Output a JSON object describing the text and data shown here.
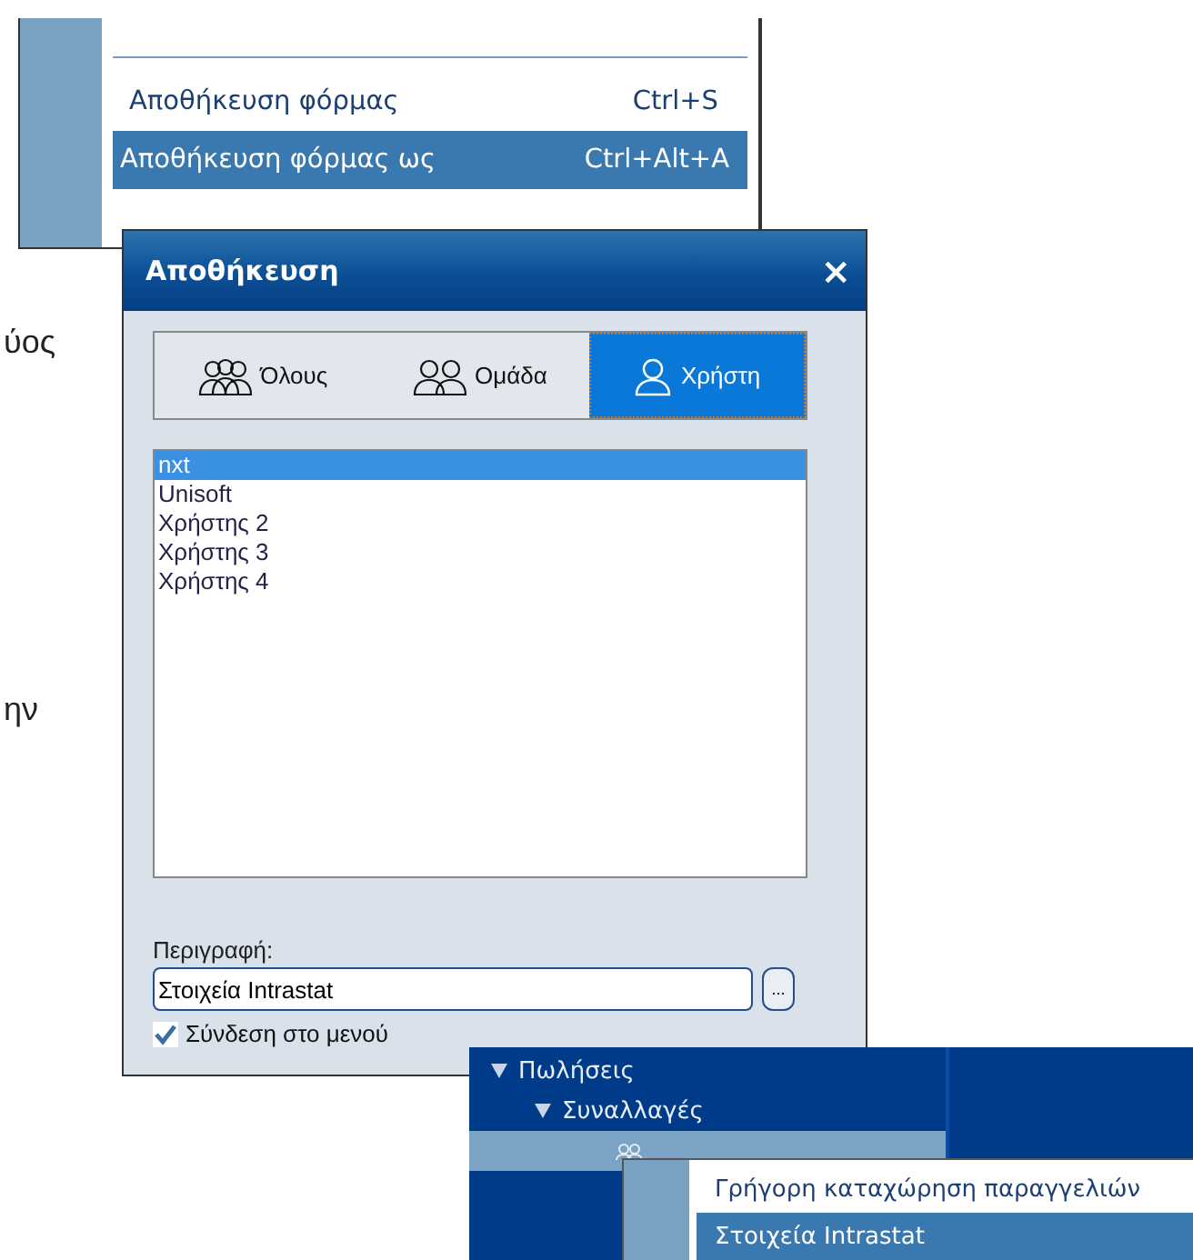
{
  "document_text": [
    "ύος",
    "ην"
  ],
  "menu": {
    "items": [
      {
        "label": "Αποθήκευση φόρμας",
        "shortcut": "Ctrl+S",
        "selected": false
      },
      {
        "label": "Αποθήκευση φόρμας ως",
        "shortcut": "Ctrl+Alt+A",
        "selected": true
      }
    ]
  },
  "dialog": {
    "title": "Αποθήκευση",
    "close": "×",
    "tabs": [
      {
        "label": "Όλους",
        "kind": "crowd",
        "selected": false
      },
      {
        "label": "Ομάδα",
        "kind": "group",
        "selected": false
      },
      {
        "label": "Χρήστη",
        "kind": "user",
        "selected": true
      }
    ],
    "users": [
      {
        "label": "nxt",
        "selected": true
      },
      {
        "label": "Unisoft",
        "selected": false
      },
      {
        "label": "Χρήστης 2",
        "selected": false
      },
      {
        "label": "Χρήστης 3",
        "selected": false
      },
      {
        "label": "Χρήστης 4",
        "selected": false
      }
    ],
    "description_label": "Περιγραφή:",
    "description_value": "Στοιχεία Intrastat",
    "browse_button": "...",
    "menu_link": {
      "label": "Σύνδεση στο μενού",
      "checked": true
    }
  },
  "tree": {
    "items": [
      {
        "label": "Πωλήσεις",
        "expanded": true,
        "children": [
          {
            "label": "Συναλλαγές",
            "expanded": true,
            "children": [
              {
                "kind": "form",
                "selected": true
              }
            ]
          }
        ]
      }
    ]
  },
  "context_menu": {
    "items": [
      {
        "label": "Γρήγορη καταχώρηση παραγγελιών",
        "selected": false
      },
      {
        "label": "Στοιχεία Intrastat",
        "selected": true
      }
    ]
  }
}
